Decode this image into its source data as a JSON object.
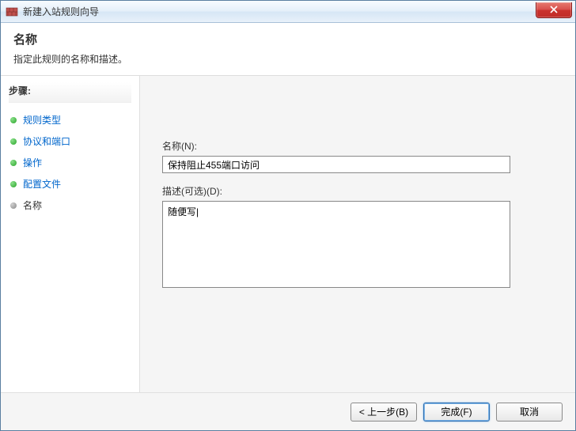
{
  "window": {
    "title": "新建入站规则向导"
  },
  "header": {
    "title": "名称",
    "subtitle": "指定此规则的名称和描述。"
  },
  "sidebar": {
    "steps_label": "步骤:",
    "items": [
      {
        "label": "规则类型",
        "current": false
      },
      {
        "label": "协议和端口",
        "current": false
      },
      {
        "label": "操作",
        "current": false
      },
      {
        "label": "配置文件",
        "current": false
      },
      {
        "label": "名称",
        "current": true
      }
    ]
  },
  "form": {
    "name_label": "名称(N):",
    "name_value": "保持阻止455端口访问",
    "desc_label": "描述(可选)(D):",
    "desc_value": "随便写|"
  },
  "footer": {
    "back": "< 上一步(B)",
    "finish": "完成(F)",
    "cancel": "取消"
  }
}
